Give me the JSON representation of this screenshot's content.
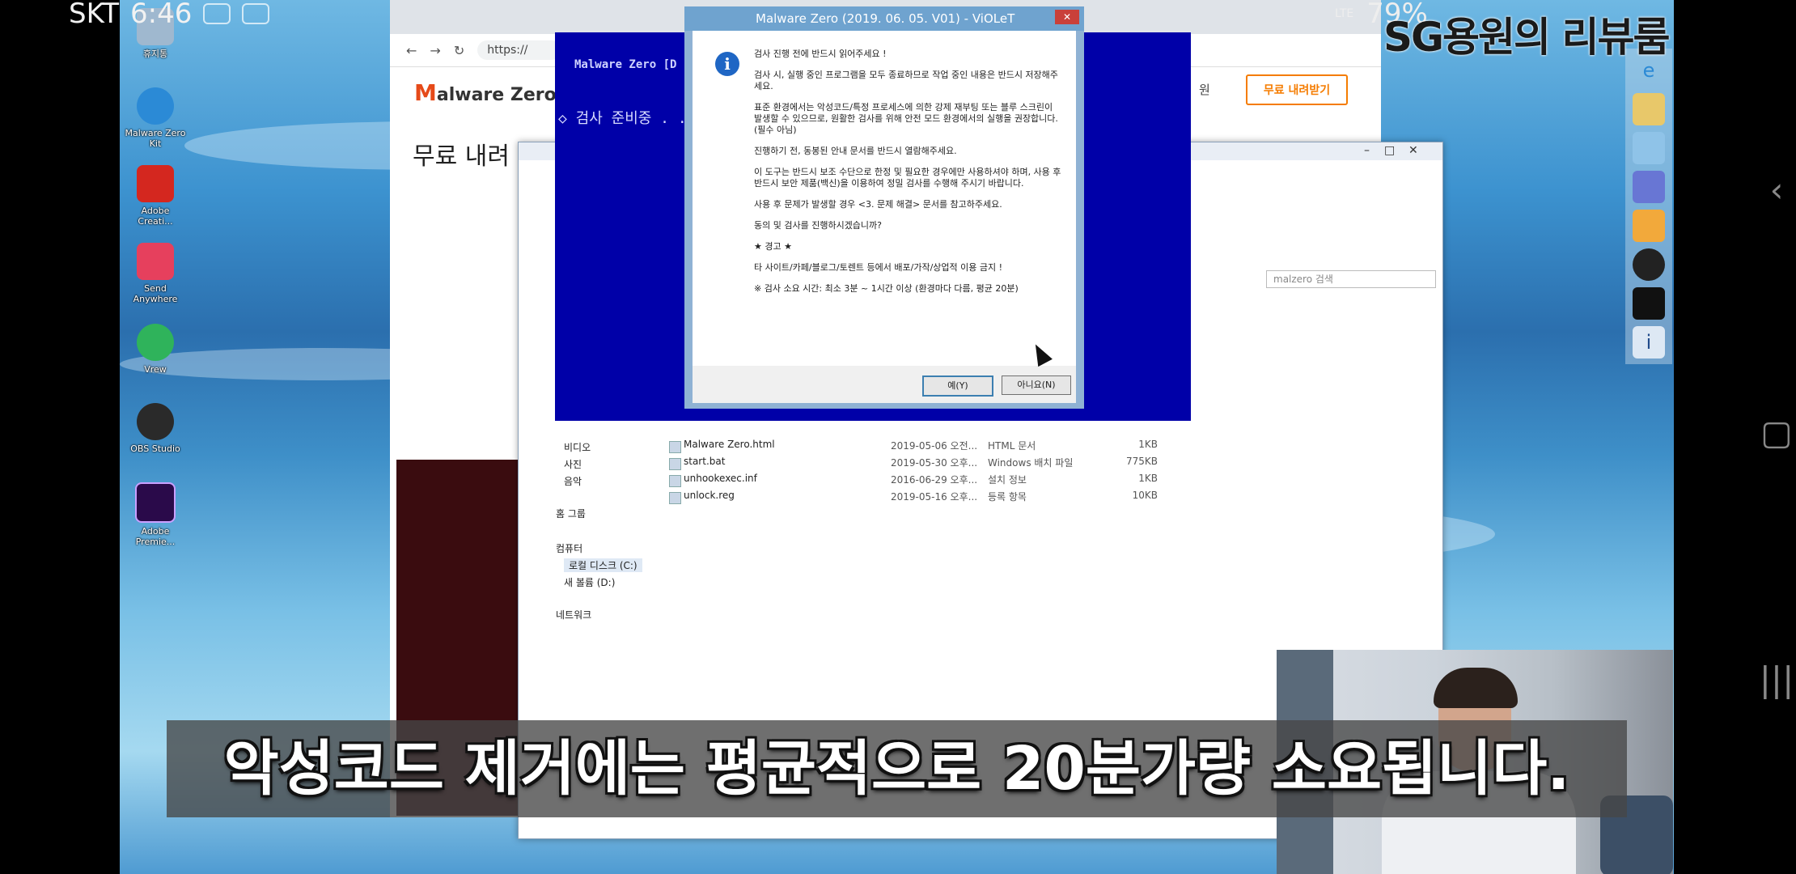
{
  "status_bar": {
    "carrier": "SKT",
    "time": "6:46",
    "network": "LTE",
    "battery": "79%"
  },
  "channel_tag": "SG용원의 리뷰룸",
  "desktop_icons": [
    {
      "label": "휴지통",
      "icon": "recycle-bin-icon",
      "color": "#9fb8cf"
    },
    {
      "label": "Malware Zero Kit",
      "icon": "ie-icon",
      "color": "#2b8ad6"
    },
    {
      "label": "Adobe Creati...",
      "icon": "adobe-cc-icon",
      "color": "#d4271f"
    },
    {
      "label": "Send Anywhere",
      "icon": "send-anywhere-icon",
      "color": "#e6405d"
    },
    {
      "label": "Vrew",
      "icon": "vrew-icon",
      "color": "#2fb35b"
    },
    {
      "label": "OBS Studio",
      "icon": "obs-icon",
      "color": "#2a2a2a"
    },
    {
      "label": "Adobe Premie...",
      "icon": "premiere-icon",
      "color": "#2a0a4a"
    }
  ],
  "taskbar_icons": [
    "ie-icon",
    "folder-icon",
    "notepad-icon",
    "discord-icon",
    "archive-icon",
    "obs-icon",
    "terminal-icon",
    "info-icon"
  ],
  "browser": {
    "url": "https://",
    "logo_m": "M",
    "logo_rest": "alware Zero",
    "nav_item": "원",
    "download_button": "무료 내려받기",
    "heading": "무료 내려"
  },
  "explorer": {
    "search_placeholder": "malzero 검색",
    "nav_tree": [
      "비디오",
      "사진",
      "음악",
      "홈 그룹",
      "컴퓨터",
      "로컬 디스크 (C:)",
      "새 볼륨 (D:)",
      "네트워크"
    ],
    "files": [
      {
        "name": "Malware Zero.html",
        "date": "2019-05-06 오전...",
        "type": "HTML 문서",
        "size": "1KB"
      },
      {
        "name": "start.bat",
        "date": "2019-05-30 오후...",
        "type": "Windows 배치 파일",
        "size": "775KB"
      },
      {
        "name": "unhookexec.inf",
        "date": "2016-06-29 오후...",
        "type": "설치 정보",
        "size": "1KB"
      },
      {
        "name": "unlock.reg",
        "date": "2019-05-16 오후...",
        "type": "등록 항목",
        "size": "10KB"
      }
    ]
  },
  "violet": {
    "window_title": "Malware Zero (2019. 06. 05. V01) - ViOLeT",
    "console_title": "Malware Zero  [D",
    "console_status": "◇ 검사 준비중 . . ."
  },
  "dialog": {
    "lines": [
      "검사 진행 전에 반드시 읽어주세요 !",
      "검사 시, 실행 중인 프로그램을 모두 종료하므로 작업 중인 내용은 반드시 저장해주세요.",
      "표준 환경에서는 악성코드/특정 프로세스에 의한 강제 재부팅 또는 블루 스크린이 발생할 수 있으므로, 원활한 검사를 위해 안전 모드 환경에서의 실행을 권장합니다. (필수 아님)",
      "진행하기 전, 동봉된 안내 문서를 반드시 열람해주세요.",
      "이 도구는 반드시 보조 수단으로 한정 및 필요한 경우에만 사용하셔야 하며, 사용 후 반드시 보안 제품(백신)을 이용하여 정밀 검사를 수행해 주시기 바랍니다.",
      "사용 후 문제가 발생할 경우 <3. 문제 해결> 문서를 참고하주세요.",
      "동의 및 검사를 진행하시겠습니까?",
      "★ 경고 ★",
      "타 사이트/카페/블로그/토렌트 등에서 배포/가작/상업적 이용 금지 !",
      "※ 검사 소요 시간: 최소 3분 ~ 1시간 이상 (환경마다 다름, 평균 20분)"
    ],
    "yes_label": "예(Y)",
    "no_label": "아니요(N)"
  },
  "subtitle": "악성코드 제거에는 평균적으로 20분가량 소요됩니다."
}
